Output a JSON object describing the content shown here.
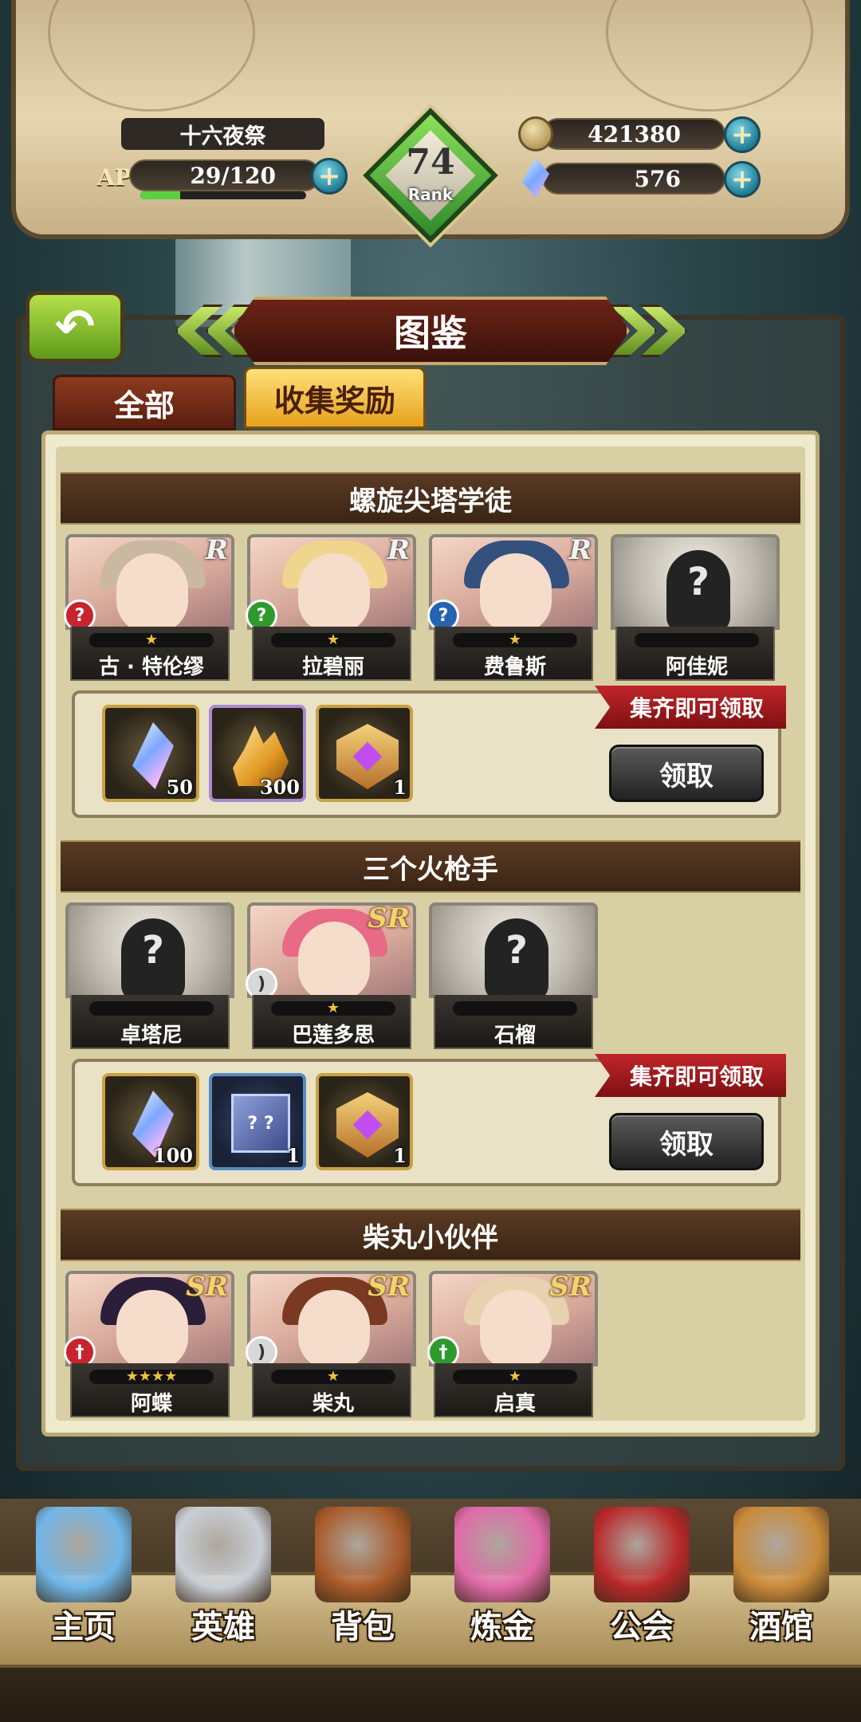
{
  "player": {
    "name": "十六夜祭",
    "ap_label": "AP",
    "ap_value": "29/120",
    "ap_fill": 0.24,
    "rank_number": "74",
    "rank_label": "Rank",
    "gold": "421380",
    "crystals": "576",
    "plus_symbol": "+"
  },
  "header": {
    "back_symbol": "↶",
    "title": "图鉴"
  },
  "tabs": [
    {
      "label": "全部",
      "active": false
    },
    {
      "label": "收集奖励",
      "active": true
    }
  ],
  "groups": [
    {
      "title": "螺旋尖塔学徒",
      "heroes": [
        {
          "name": "古 · 特伦缪",
          "rarity": "R",
          "stars": "★",
          "known": true,
          "class_color": "#c8232e",
          "class_icon": "?"
        },
        {
          "name": "拉碧丽",
          "rarity": "R",
          "stars": "★",
          "known": true,
          "class_color": "#2e9a2e",
          "class_icon": "?"
        },
        {
          "name": "费鲁斯",
          "rarity": "R",
          "stars": "★",
          "known": true,
          "class_color": "#2464b0",
          "class_icon": "?"
        },
        {
          "name": "阿佳妮",
          "rarity": "",
          "stars": "",
          "known": false,
          "unknown_mark": "?"
        }
      ],
      "rewards": [
        {
          "type": "crystal",
          "count": "50"
        },
        {
          "type": "amber",
          "count": "300"
        },
        {
          "type": "badge",
          "count": "1"
        }
      ],
      "ribbon": "集齐即可领取",
      "claim": "领取"
    },
    {
      "title": "三个火枪手",
      "heroes": [
        {
          "name": "卓塔尼",
          "rarity": "",
          "stars": "",
          "known": false,
          "unknown_mark": "?"
        },
        {
          "name": "巴莲多思",
          "rarity": "SR",
          "stars": "★",
          "known": true,
          "class_color": "#d8d8d8",
          "class_icon": ")"
        },
        {
          "name": "石榴",
          "rarity": "",
          "stars": "",
          "known": false,
          "unknown_mark": "?"
        }
      ],
      "rewards": [
        {
          "type": "crystal",
          "count": "100"
        },
        {
          "type": "box",
          "count": "1",
          "box_text": "? ?"
        },
        {
          "type": "badge",
          "count": "1"
        }
      ],
      "ribbon": "集齐即可领取",
      "claim": "领取"
    },
    {
      "title": "柴丸小伙伴",
      "heroes": [
        {
          "name": "阿蝶",
          "rarity": "SR",
          "stars": "★★★★",
          "known": true,
          "class_color": "#c8232e",
          "class_icon": "†"
        },
        {
          "name": "柴丸",
          "rarity": "SR",
          "stars": "★",
          "known": true,
          "class_color": "#d8d8d8",
          "class_icon": ")"
        },
        {
          "name": "启真",
          "rarity": "SR",
          "stars": "★",
          "known": true,
          "class_color": "#2e9a2e",
          "class_icon": "†"
        }
      ]
    }
  ],
  "nav": [
    {
      "label": "主页",
      "icon": "castle-icon",
      "color": "#6fb6e8"
    },
    {
      "label": "英雄",
      "icon": "hero-helmet-icon",
      "color": "#c9ced6"
    },
    {
      "label": "背包",
      "icon": "backpack-icon",
      "color": "#a85a2a"
    },
    {
      "label": "炼金",
      "icon": "potion-flask-icon",
      "color": "#e06aa8"
    },
    {
      "label": "公会",
      "icon": "guild-shield-icon",
      "color": "#b8282a"
    },
    {
      "label": "酒馆",
      "icon": "tavern-mug-icon",
      "color": "#c98a3a"
    }
  ]
}
